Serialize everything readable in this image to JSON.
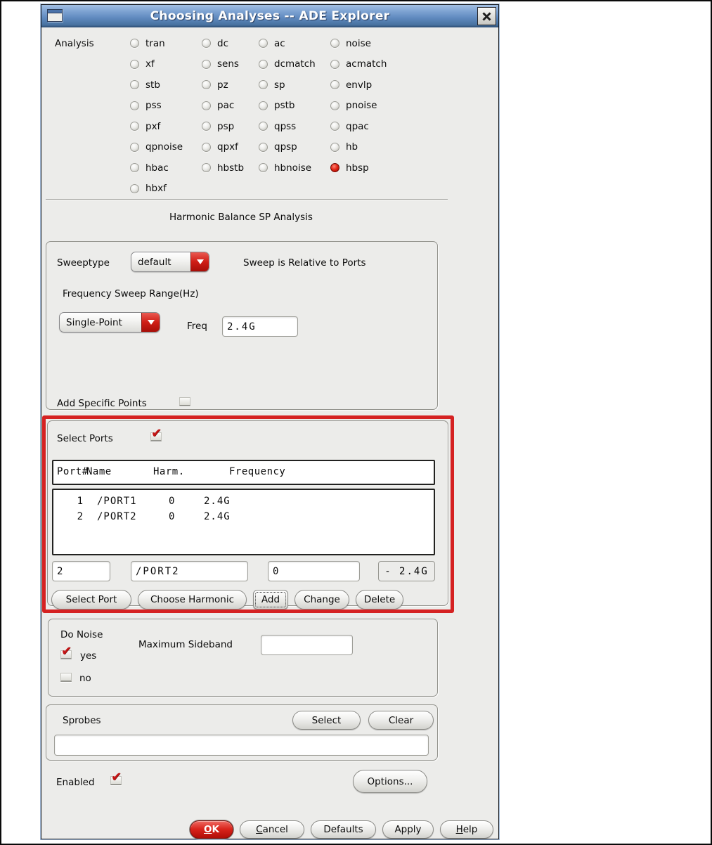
{
  "window": {
    "title": "Choosing Analyses -- ADE Explorer"
  },
  "analysis": {
    "label": "Analysis",
    "options": [
      "tran",
      "dc",
      "ac",
      "noise",
      "xf",
      "sens",
      "dcmatch",
      "acmatch",
      "stb",
      "pz",
      "sp",
      "envlp",
      "pss",
      "pac",
      "pstb",
      "pnoise",
      "pxf",
      "psp",
      "qpss",
      "qpac",
      "qpnoise",
      "qpxf",
      "qpsp",
      "hb",
      "hbac",
      "hbstb",
      "hbnoise",
      "hbsp",
      "hbxf"
    ],
    "selected": "hbsp"
  },
  "section_title": "Harmonic Balance SP Analysis",
  "sweep": {
    "sweeptype_label": "Sweeptype",
    "sweeptype_value": "default",
    "relative_note": "Sweep is Relative to Ports",
    "freq_range_label": "Frequency Sweep Range(Hz)",
    "range_type_value": "Single-Point",
    "freq_label": "Freq",
    "freq_value": "2.4G",
    "add_points_label": "Add Specific Points",
    "add_points_checked": false
  },
  "select_ports": {
    "label": "Select Ports",
    "checked": true,
    "table": {
      "columns": [
        "Port#",
        "Name",
        "Harm.",
        "Frequency"
      ],
      "rows": [
        [
          "1",
          "/PORT1",
          "0",
          "2.4G"
        ],
        [
          "2",
          "/PORT2",
          "0",
          "2.4G"
        ]
      ]
    },
    "port_number_value": "2",
    "port_name_value": "/PORT2",
    "harmonic_value": "0",
    "frequency_display": "- 2.4G",
    "buttons": [
      {
        "label": "Select Port",
        "focused": false
      },
      {
        "label": "Choose Harmonic",
        "focused": false
      },
      {
        "label": "Add",
        "focused": true
      },
      {
        "label": "Change",
        "focused": false
      },
      {
        "label": "Delete",
        "focused": false
      }
    ]
  },
  "do_noise": {
    "label": "Do Noise",
    "yes_label": "yes",
    "yes_checked": true,
    "no_label": "no",
    "no_checked": false,
    "max_sideband_label": "Maximum Sideband",
    "max_sideband_value": ""
  },
  "sprobes": {
    "label": "Sprobes",
    "select_button": "Select",
    "clear_button": "Clear",
    "value": ""
  },
  "footer": {
    "enabled_label": "Enabled",
    "enabled_checked": true,
    "options_button": "Options...",
    "buttons": [
      {
        "label": "OK",
        "underline": 0,
        "primary": true
      },
      {
        "label": "Cancel",
        "underline": 0,
        "primary": false
      },
      {
        "label": "Defaults",
        "underline": null,
        "primary": false
      },
      {
        "label": "Apply",
        "underline": null,
        "primary": false
      },
      {
        "label": "Help",
        "underline": 0,
        "primary": false
      }
    ]
  },
  "colors": {
    "accent_red": "#c41414",
    "titlebar_blue": "#5d87bd",
    "annotation_red": "#d52222",
    "body_gray": "#ececea"
  }
}
